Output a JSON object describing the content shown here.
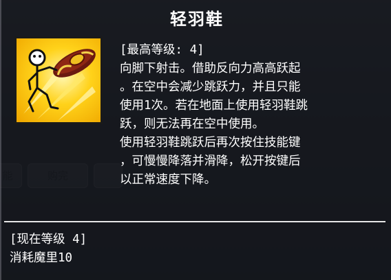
{
  "skill": {
    "name": "轻羽鞋",
    "icon": "jumping-figure-icon",
    "max_level_line": "[最高等级: 4]",
    "description_lines": [
      "向脚下射击。借助反向力高高跃起",
      "。在空中会减少跳跃力，并且只能",
      "使用1次。若在地面上使用轻羽鞋跳",
      "跃，则无法再在空中使用。",
      "使用轻羽鞋跳跃后再次按住技能键",
      "，可慢慢降落并滑降，松开按键后",
      "以正常速度下降。"
    ],
    "current_level_line": "[现在等级 4]",
    "cost_line": "消耗魔里10"
  },
  "background": {
    "tabs": [
      "能",
      "购完",
      ""
    ]
  },
  "colors": {
    "panel": "#0e1016",
    "text": "#ffffff",
    "icon_bg": "#ffd21a"
  }
}
